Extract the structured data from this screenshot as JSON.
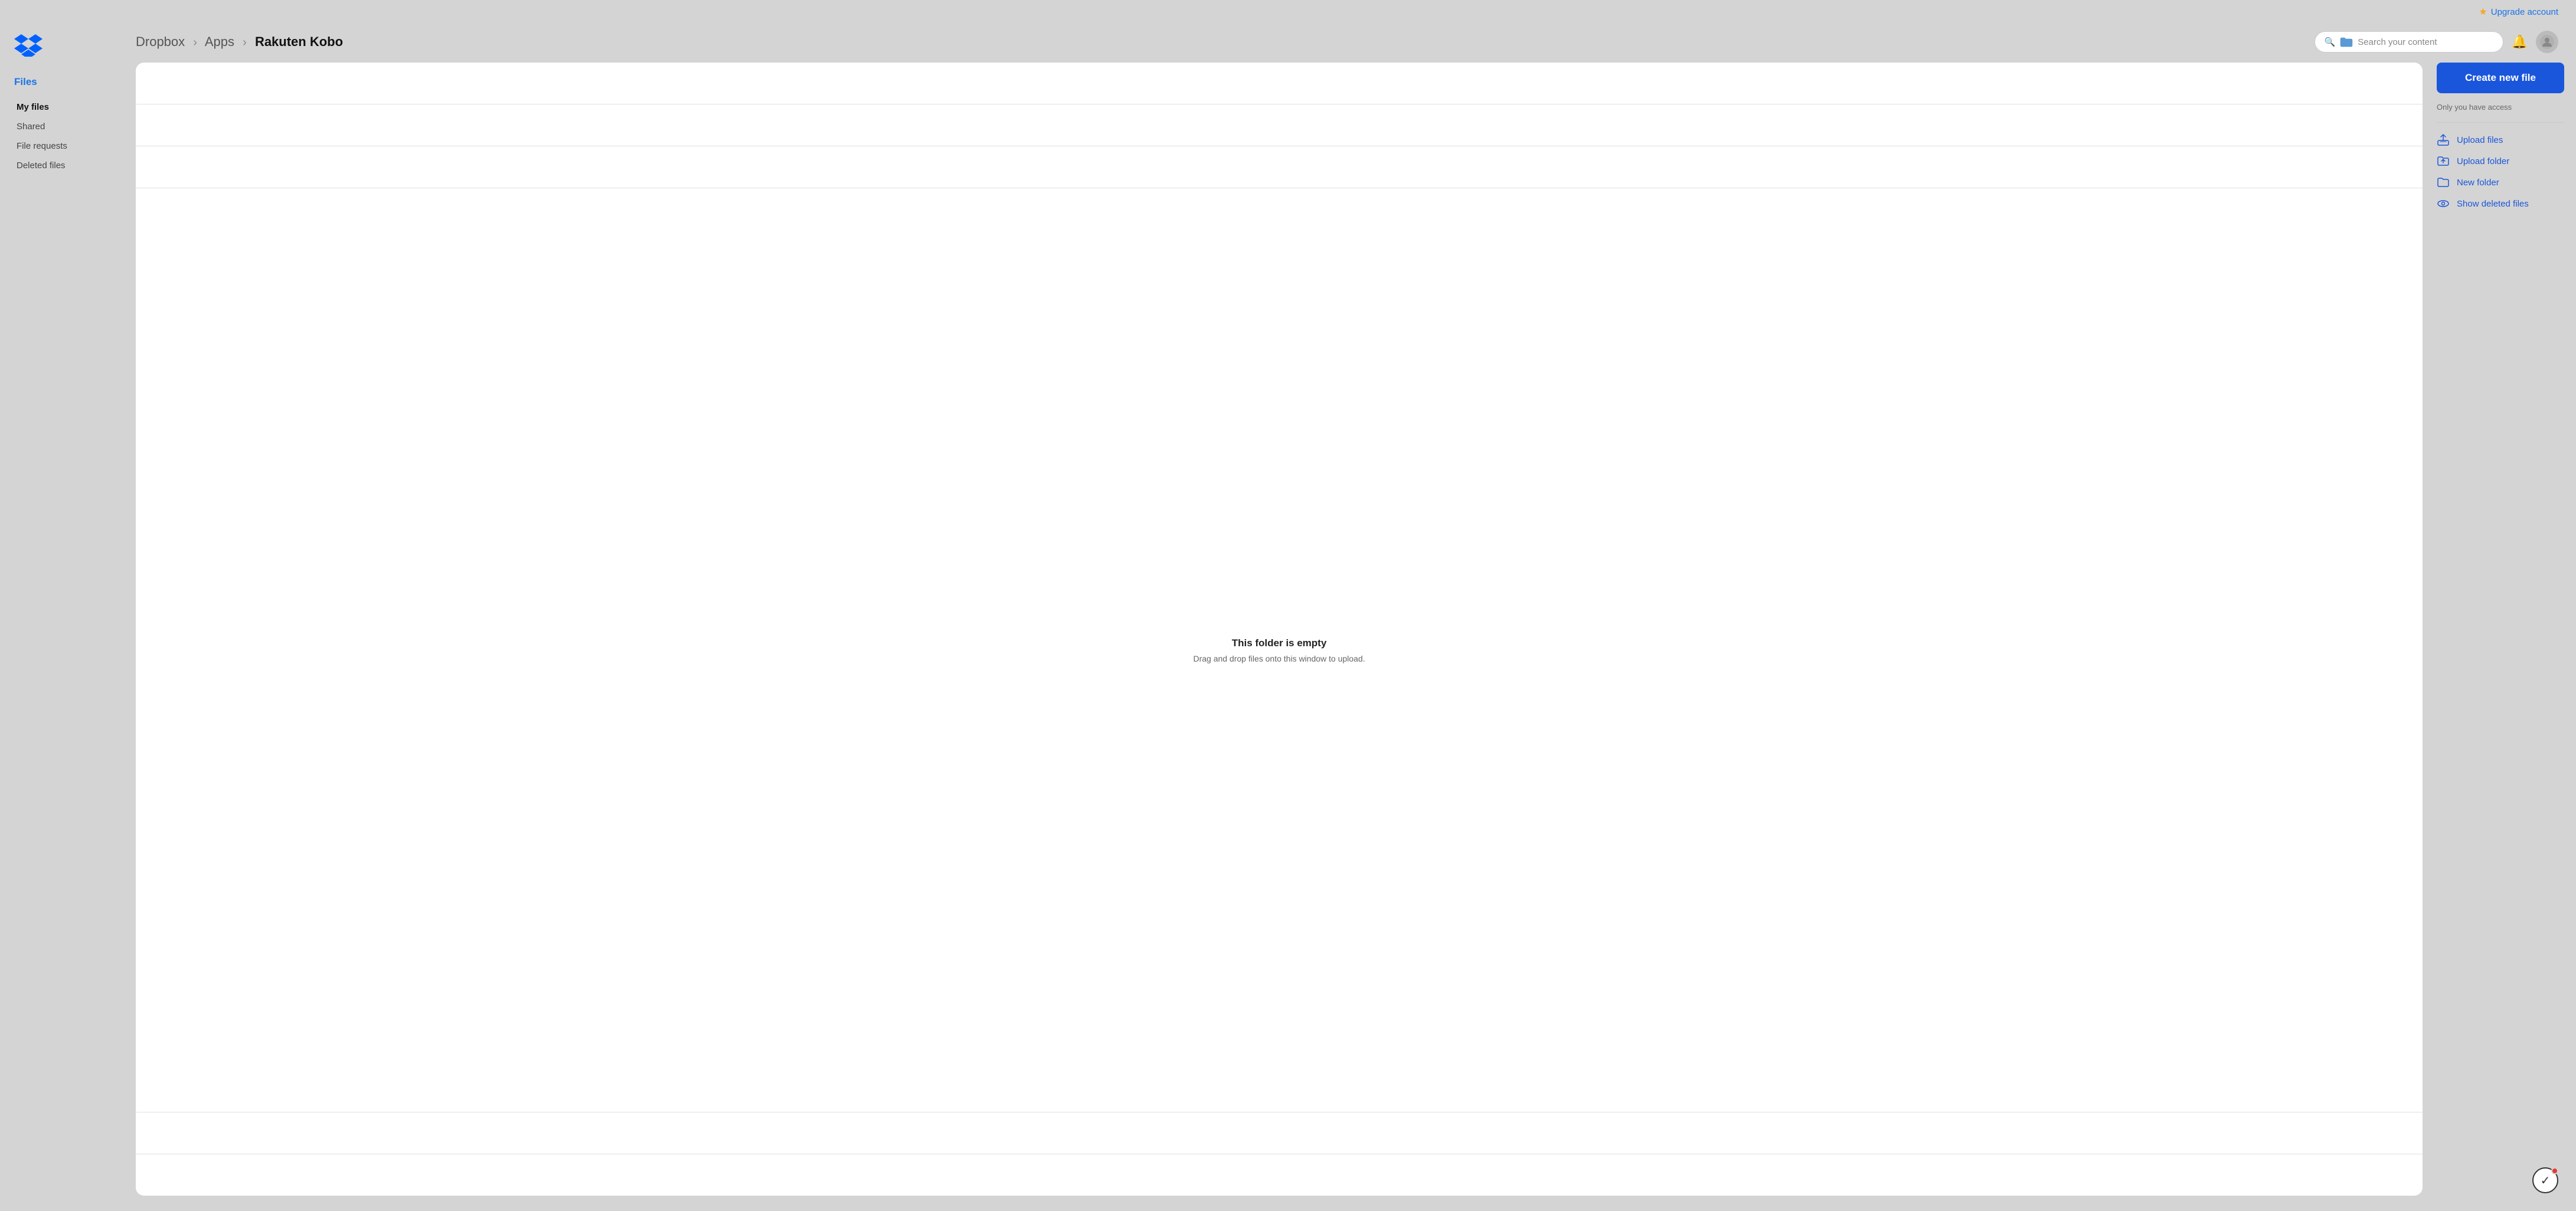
{
  "topbar": {
    "upgrade_label": "Upgrade account"
  },
  "sidebar": {
    "section_title": "Files",
    "nav_items": [
      {
        "id": "my-files",
        "label": "My files",
        "active": true
      },
      {
        "id": "shared",
        "label": "Shared",
        "active": false
      },
      {
        "id": "file-requests",
        "label": "File requests",
        "active": false
      },
      {
        "id": "deleted-files",
        "label": "Deleted files",
        "active": false
      }
    ]
  },
  "breadcrumb": {
    "parts": [
      {
        "label": "Dropbox",
        "bold": false
      },
      {
        "label": "Apps",
        "bold": false
      },
      {
        "label": "Rakuten Kobo",
        "bold": true
      }
    ]
  },
  "search": {
    "placeholder": "Search your content"
  },
  "empty_state": {
    "title": "This folder is empty",
    "subtitle": "Drag and drop files onto this window to upload."
  },
  "right_panel": {
    "create_button_label": "Create new file",
    "access_note": "Only you have access",
    "actions": [
      {
        "id": "upload-files",
        "label": "Upload files",
        "icon": "upload-file-icon"
      },
      {
        "id": "upload-folder",
        "label": "Upload folder",
        "icon": "upload-folder-icon"
      },
      {
        "id": "new-folder",
        "label": "New folder",
        "icon": "new-folder-icon"
      },
      {
        "id": "show-deleted",
        "label": "Show deleted files",
        "icon": "eye-icon"
      }
    ]
  },
  "icons": {
    "star": "★",
    "bell": "🔔",
    "check": "✓"
  }
}
